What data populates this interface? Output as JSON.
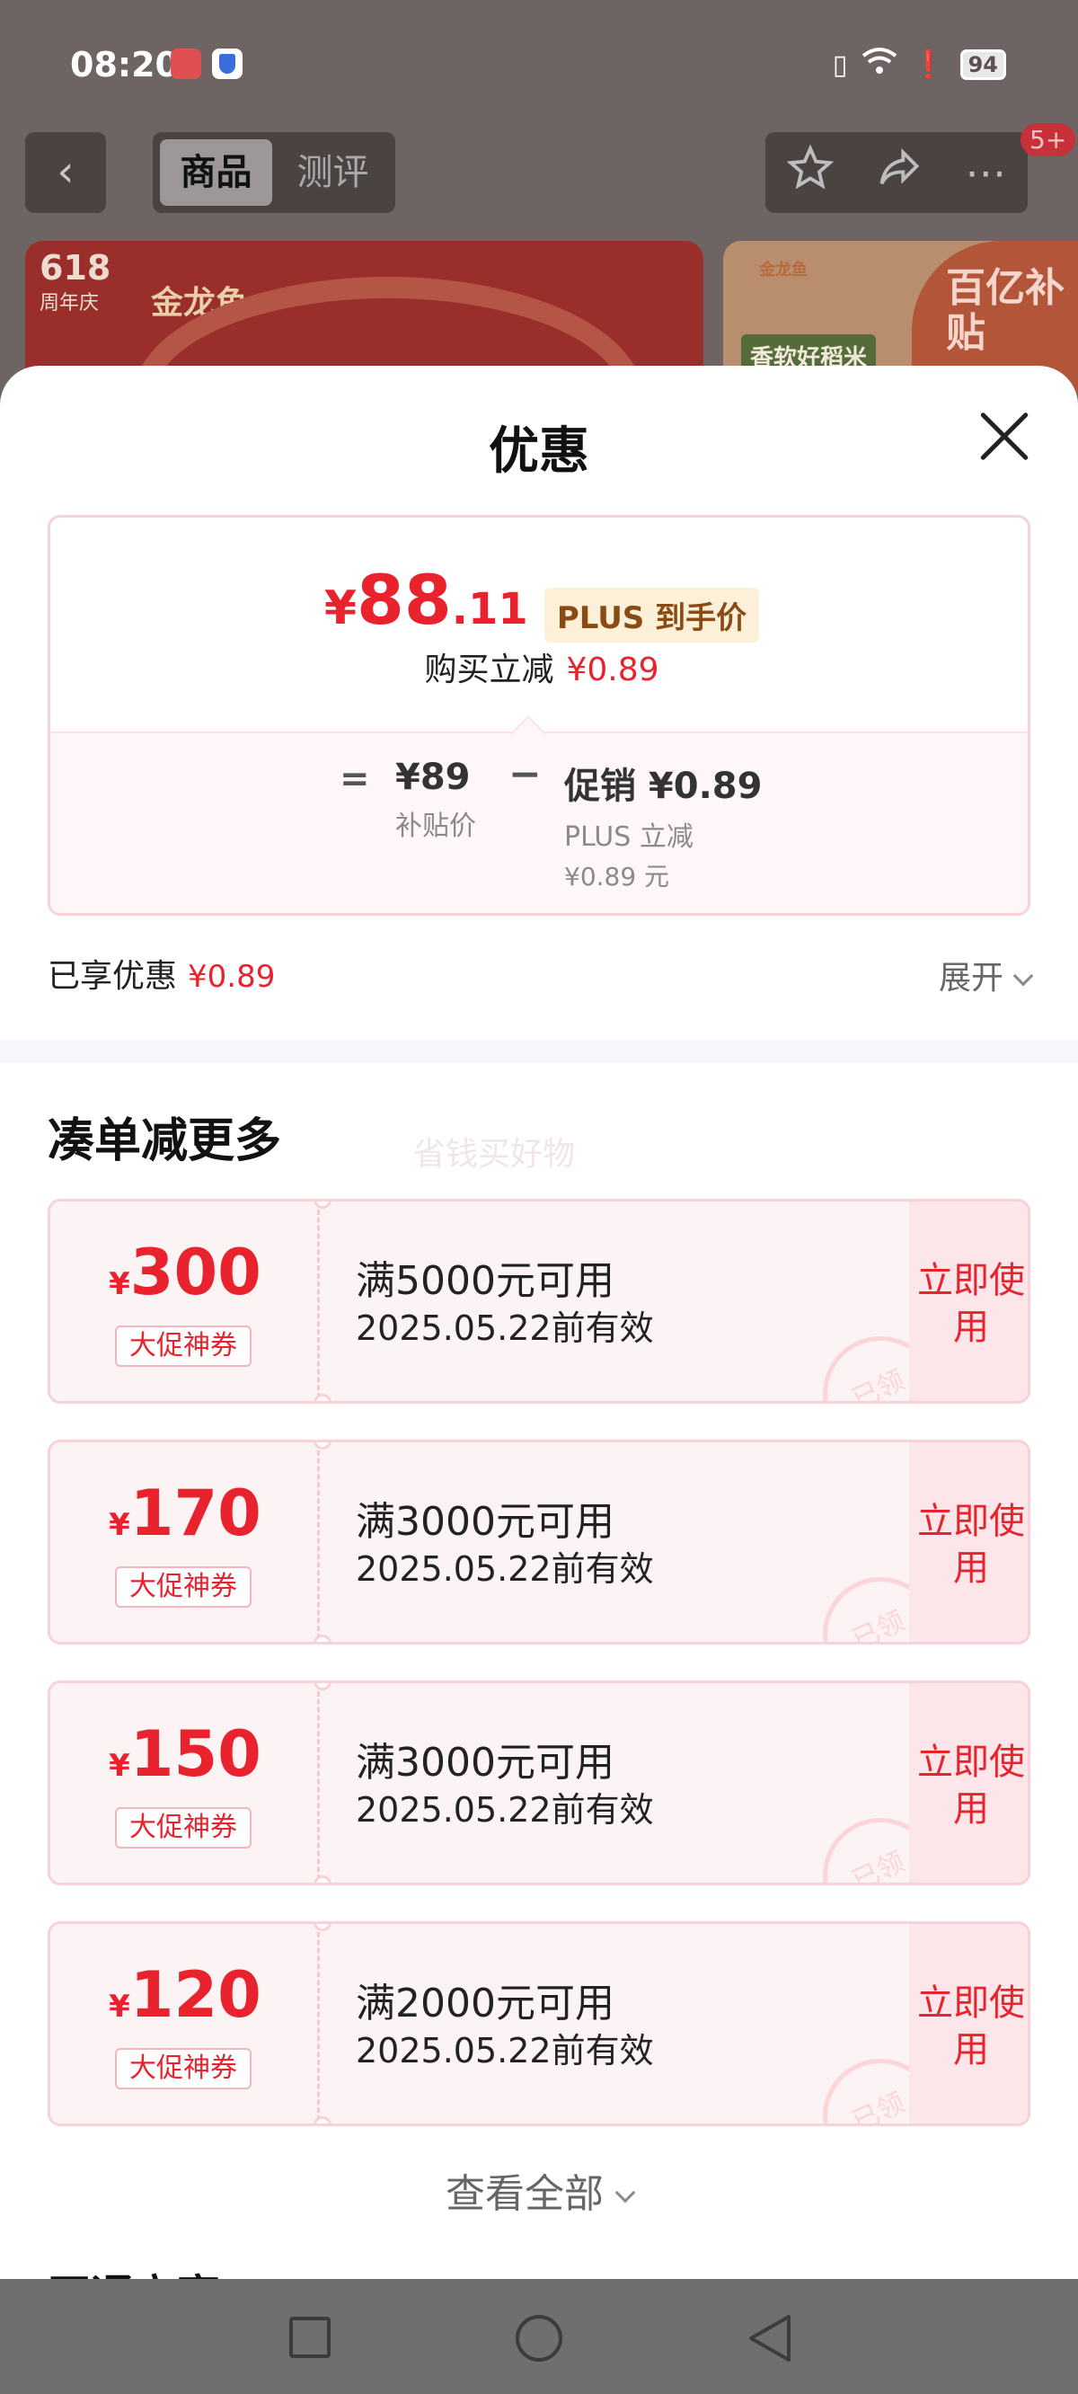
{
  "status_bar": {
    "time": "08:20",
    "battery": "94",
    "network": "6"
  },
  "top_nav": {
    "tabs": [
      "商品",
      "测评"
    ],
    "badge": "5+"
  },
  "banners": {
    "left_618": "618",
    "left_618_sub": "周年庆",
    "left_brand": "金龙鱼",
    "right_logo": "金龙鱼",
    "right_ribbon": "香软好稻米",
    "right_subsidy": "百亿补贴"
  },
  "sheet": {
    "title": "优惠",
    "price_card": {
      "yen": "¥",
      "price_int": "88",
      "price_dec": ".11",
      "plus_tag": "PLUS 到手价",
      "reduce_label": "购买立减",
      "reduce_amount": "¥0.89",
      "eq": "=",
      "subsidy_value": "¥89",
      "subsidy_label": "补贴价",
      "minus": "−",
      "promo_value": "促销 ¥0.89",
      "promo_label": "PLUS 立减",
      "promo_sub": "¥0.89 元"
    },
    "enjoy": {
      "label": "已享优惠",
      "amount": "¥0.89",
      "expand": "展开"
    },
    "section_title": "凑单减更多",
    "watermark": "省钱买好物",
    "coupons": [
      {
        "yen": "¥",
        "amount": "300",
        "tag": "大促神券",
        "condition": "满5000元可用",
        "date": "2025.05.22前有效",
        "button": "立即使用",
        "stamp": "已领"
      },
      {
        "yen": "¥",
        "amount": "170",
        "tag": "大促神券",
        "condition": "满3000元可用",
        "date": "2025.05.22前有效",
        "button": "立即使用",
        "stamp": "已领"
      },
      {
        "yen": "¥",
        "amount": "150",
        "tag": "大促神券",
        "condition": "满3000元可用",
        "date": "2025.05.22前有效",
        "button": "立即使用",
        "stamp": "已领"
      },
      {
        "yen": "¥",
        "amount": "120",
        "tag": "大促神券",
        "condition": "满2000元可用",
        "date": "2025.05.22前有效",
        "button": "立即使用",
        "stamp": "已领"
      }
    ],
    "view_all": "查看全部",
    "next_section_title": "开通立享"
  },
  "icons": {
    "back": "back-arrow-icon",
    "star": "star-icon",
    "share": "share-icon",
    "more": "more-icon",
    "close": "close-icon"
  },
  "colors": {
    "accent_red": "#e8232e",
    "plus_tag_bg": "#fdf0d9",
    "plus_tag_text": "#8a4a13",
    "coupon_bg": "#fcf3f4",
    "coupon_border": "#f7d3d8"
  }
}
